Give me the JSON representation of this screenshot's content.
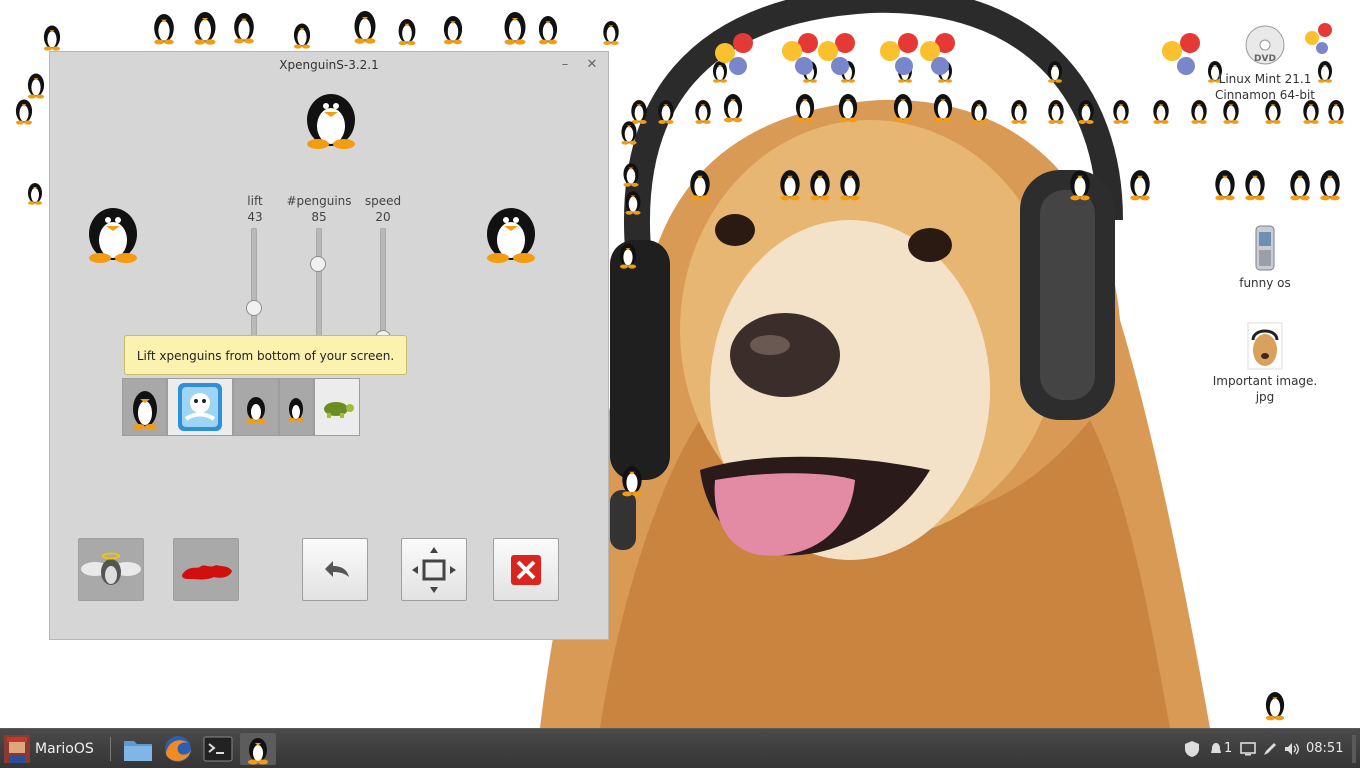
{
  "window": {
    "title": "XpenguinS-3.2.1",
    "sliders": [
      {
        "label": "lift",
        "value": "43",
        "level": 0.43
      },
      {
        "label": "#penguins",
        "value": "85",
        "level": 0.85
      },
      {
        "label": "speed",
        "value": "20",
        "level": 0.2
      }
    ],
    "tooltip": "Lift xpenguins from bottom of your screen.",
    "theme_buttons": [
      "penguins-theme",
      "big-baby-theme",
      "small-penguin-theme",
      "tiny-penguin-theme",
      "turtle-theme"
    ],
    "action_buttons": [
      "angel-penguin-button",
      "blood-splat-button",
      "undo-button",
      "fit-screen-button",
      "close-red-button"
    ]
  },
  "desktop": {
    "icons": [
      {
        "label": "Linux Mint 21.1 Cinnamon 64-bit"
      },
      {
        "label": "funny os"
      },
      {
        "label": "Important image.\njpg"
      }
    ]
  },
  "taskbar": {
    "menu_label": "MarioOS",
    "launchers": [
      "files",
      "firefox",
      "terminal",
      "xpenguins"
    ],
    "workspace": "1",
    "clock": "08:51"
  },
  "colors": {
    "window_bg": "#d6d6d6",
    "tooltip_bg": "#fbf2b0",
    "taskbar_bg": "#3d3d3d",
    "close_red": "#d9251d"
  }
}
